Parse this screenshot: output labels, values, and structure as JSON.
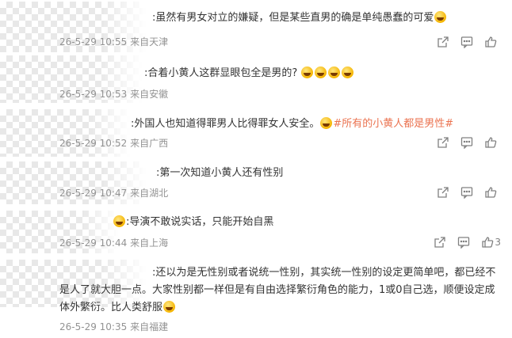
{
  "comments": [
    {
      "text": ":虽然有男女对立的嫌疑，但是某些直男的确是单纯愚蠢的可爱",
      "time": "26-5-29 10:55",
      "location": "来自天津",
      "likes": ""
    },
    {
      "text": ":合着小黄人这群显眼包全是男的?",
      "time": "26-5-29 10:53",
      "location": "来自安徽",
      "likes": ""
    },
    {
      "text": ":外国人也知道得罪男人比得罪女人安全。",
      "topic": "#所有的小黄人都是男性#",
      "time": "26-5-29 10:52",
      "location": "来自广西",
      "likes": ""
    },
    {
      "text": ":第一次知道小黄人还有性别",
      "time": "26-5-29 10:47",
      "location": "来自湖北",
      "likes": ""
    },
    {
      "text": ":导演不敢说实话，只能开始自黑",
      "time": "26-5-29 10:44",
      "location": "来自上海",
      "likes": "3"
    },
    {
      "text": ":还以为是无性别或者说统一性别，其实统一性别的设定更简单吧，都已经不是人了就大胆一点。大家性别都一样但是有自由选择繁衍角色的能力，1或0自己选，顺便设定成体外繁衍。比人类舒服",
      "time": "26-5-29 10:35",
      "location": "来自福建",
      "likes": ""
    }
  ],
  "icons": {
    "share": "share-icon",
    "comment": "comment-icon",
    "like": "like-icon"
  },
  "colors": {
    "topic": "#eb7350",
    "meta": "#939393",
    "icon": "#808080"
  }
}
